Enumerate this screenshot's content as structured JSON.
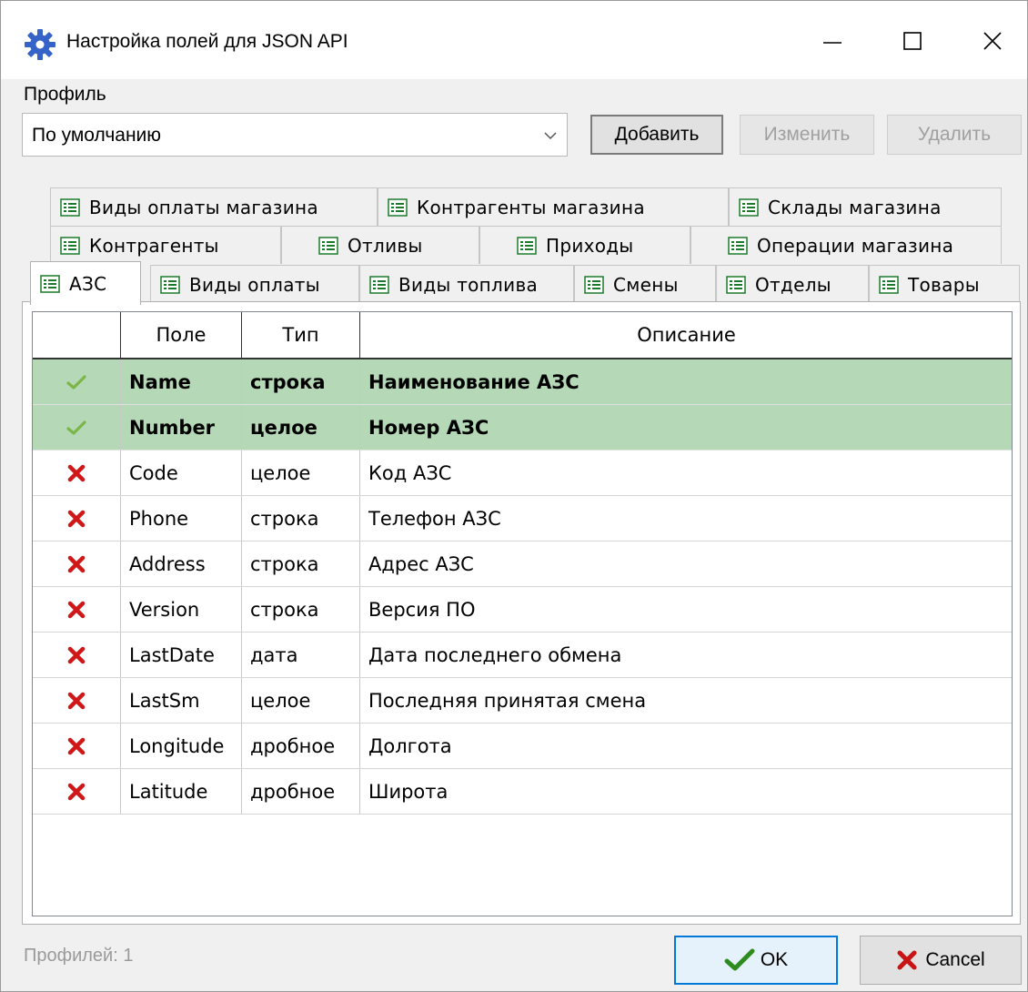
{
  "window": {
    "title": "Настройка полей для JSON API",
    "controls": {
      "minimize": "minimize-icon",
      "maximize": "maximize-icon",
      "close": "close-icon"
    }
  },
  "profile": {
    "label": "Профиль",
    "selected": "По умолчанию",
    "add_label": "Добавить",
    "edit_label": "Изменить",
    "delete_label": "Удалить"
  },
  "tabs": {
    "row1": [
      "Виды оплаты магазина",
      "Контрагенты магазина",
      "Склады магазина"
    ],
    "row2": [
      "Контрагенты",
      "Отливы",
      "Приходы",
      "Операции магазина"
    ],
    "row3": [
      "АЗС",
      "Виды оплаты",
      "Виды топлива",
      "Смены",
      "Отделы",
      "Товары"
    ],
    "active": "АЗС"
  },
  "grid": {
    "headers": [
      "",
      "Поле",
      "Тип",
      "Описание"
    ],
    "rows": [
      {
        "enabled": true,
        "field": "Name",
        "type": "строка",
        "description": "Наименование АЗС"
      },
      {
        "enabled": true,
        "field": "Number",
        "type": "целое",
        "description": "Номер АЗС"
      },
      {
        "enabled": false,
        "field": "Code",
        "type": "целое",
        "description": "Код АЗС"
      },
      {
        "enabled": false,
        "field": "Phone",
        "type": "строка",
        "description": "Телефон АЗС"
      },
      {
        "enabled": false,
        "field": "Address",
        "type": "строка",
        "description": "Адрес АЗС"
      },
      {
        "enabled": false,
        "field": "Version",
        "type": "строка",
        "description": "Версия ПО"
      },
      {
        "enabled": false,
        "field": "LastDate",
        "type": "дата",
        "description": "Дата последнего обмена"
      },
      {
        "enabled": false,
        "field": "LastSm",
        "type": "целое",
        "description": "Последняя принятая смена"
      },
      {
        "enabled": false,
        "field": "Longitude",
        "type": "дробное",
        "description": "Долгота"
      },
      {
        "enabled": false,
        "field": "Latitude",
        "type": "дробное",
        "description": "Широта"
      }
    ],
    "highlight_color": "#b5d8b7",
    "check_color": "#7ab648",
    "cross_color": "#d01818"
  },
  "footer": {
    "status": "Профилей: 1",
    "ok_label": "OK",
    "cancel_label": "Cancel"
  }
}
